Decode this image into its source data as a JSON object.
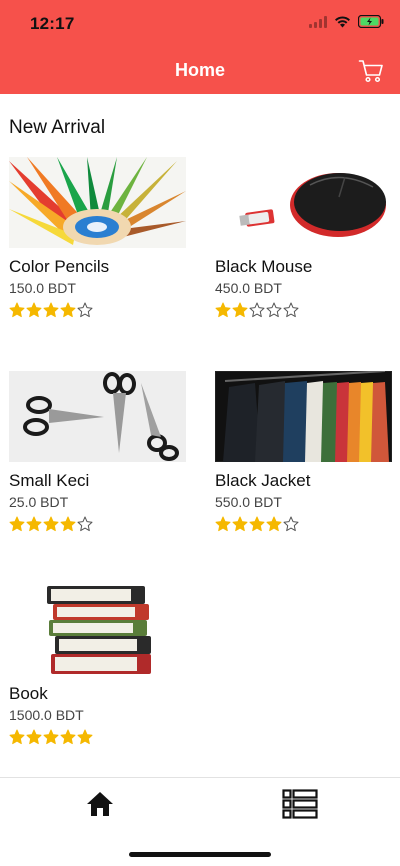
{
  "status_bar": {
    "time": "12:17"
  },
  "nav": {
    "title": "Home"
  },
  "section": {
    "title": "New Arrival"
  },
  "products": [
    {
      "name": "Color Pencils",
      "price": "150.0 BDT",
      "rating": 4,
      "max_rating": 5
    },
    {
      "name": "Black Mouse",
      "price": "450.0 BDT",
      "rating": 2,
      "max_rating": 5
    },
    {
      "name": "Small Keci",
      "price": "25.0 BDT",
      "rating": 4,
      "max_rating": 5
    },
    {
      "name": "Black Jacket",
      "price": "550.0 BDT",
      "rating": 4,
      "max_rating": 5
    },
    {
      "name": "Book",
      "price": "1500.0 BDT",
      "rating": 5,
      "max_rating": 5
    }
  ],
  "colors": {
    "accent": "#f6514b",
    "star_filled": "#f5b800",
    "star_outline": "#555555"
  },
  "icons": {
    "cart": "cart-icon",
    "home": "home-icon",
    "list": "list-icon",
    "signal": "signal-icon",
    "wifi": "wifi-icon",
    "battery": "battery-icon"
  }
}
